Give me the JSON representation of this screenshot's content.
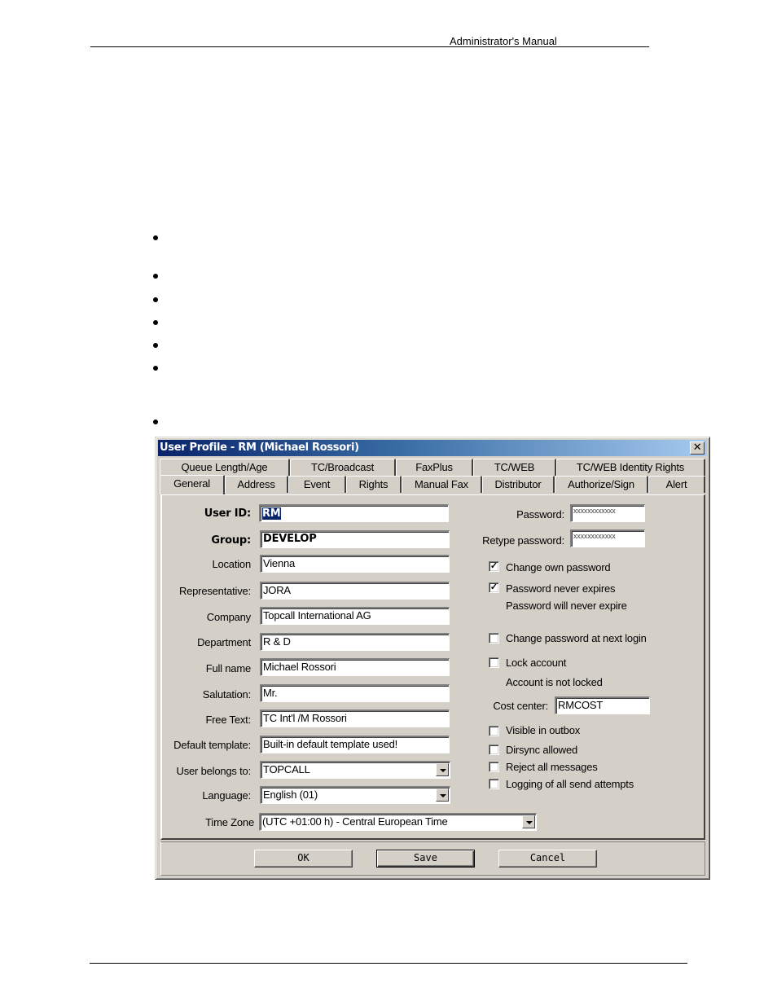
{
  "page": {
    "header_text": "Administrator's Manual",
    "bullet_count": 7
  },
  "dialog": {
    "title": "User Profile - RM (Michael Rossori)",
    "close_glyph": "✕",
    "tabs_row1": [
      {
        "label": "Queue Length/Age"
      },
      {
        "label": "TC/Broadcast"
      },
      {
        "label": "FaxPlus"
      },
      {
        "label": "TC/WEB"
      },
      {
        "label": "TC/WEB Identity Rights"
      }
    ],
    "tabs_row2": [
      {
        "label": "General",
        "active": true
      },
      {
        "label": "Address"
      },
      {
        "label": "Event"
      },
      {
        "label": "Rights"
      },
      {
        "label": "Manual Fax"
      },
      {
        "label": "Distributor"
      },
      {
        "label": "Authorize/Sign"
      },
      {
        "label": "Alert"
      }
    ],
    "fields": {
      "user_id": {
        "label": "User ID:",
        "value": "RM"
      },
      "group": {
        "label": "Group:",
        "value": "DEVELOP"
      },
      "location": {
        "label": "Location",
        "value": "Vienna"
      },
      "representative": {
        "label": "Representative:",
        "value": "JORA"
      },
      "company": {
        "label": "Company",
        "value": "Topcall International AG"
      },
      "department": {
        "label": "Department",
        "value": "R & D"
      },
      "full_name": {
        "label": "Full name",
        "value": "Michael Rossori"
      },
      "salutation": {
        "label": "Salutation:",
        "value": "Mr."
      },
      "free_text": {
        "label": "Free Text:",
        "value": "TC Int'l /M Rossori"
      },
      "default_template": {
        "label": "Default template:",
        "value": "Built-in default template used!"
      },
      "user_belongs_to": {
        "label": "User belongs to:",
        "value": "TOPCALL"
      },
      "language": {
        "label": "Language:",
        "value": "English (01)"
      },
      "time_zone": {
        "label": "Time Zone",
        "value": "(UTC +01:00 h) - Central European Time"
      },
      "password": {
        "label": "Password:",
        "value": "xxxxxxxxxxxx"
      },
      "retype_password": {
        "label": "Retype password:",
        "value": "xxxxxxxxxxxx"
      },
      "cost_center": {
        "label": "Cost center:",
        "value": "RMCOST"
      }
    },
    "checkboxes": {
      "change_own_password": {
        "label": "Change own password",
        "checked": true
      },
      "password_never_expires": {
        "label": "Password never expires",
        "checked": true
      },
      "change_password_next_login": {
        "label": "Change password at next login",
        "checked": false
      },
      "lock_account": {
        "label": "Lock account",
        "checked": false
      },
      "visible_in_outbox": {
        "label": "Visible in outbox",
        "checked": false
      },
      "dirsync_allowed": {
        "label": "Dirsync allowed",
        "checked": false
      },
      "reject_all_messages": {
        "label": "Reject all messages",
        "checked": false
      },
      "logging_send_attempts": {
        "label": "Logging of all send attempts",
        "checked": false
      }
    },
    "status": {
      "password_expiry": "Password will never expire",
      "account_lock": "Account is not locked"
    },
    "buttons": {
      "ok": "OK",
      "save": "Save",
      "cancel": "Cancel"
    },
    "colors": {
      "titlebar_start": "#0a246a",
      "titlebar_end": "#a6caf0",
      "face": "#d4d0c8"
    }
  }
}
